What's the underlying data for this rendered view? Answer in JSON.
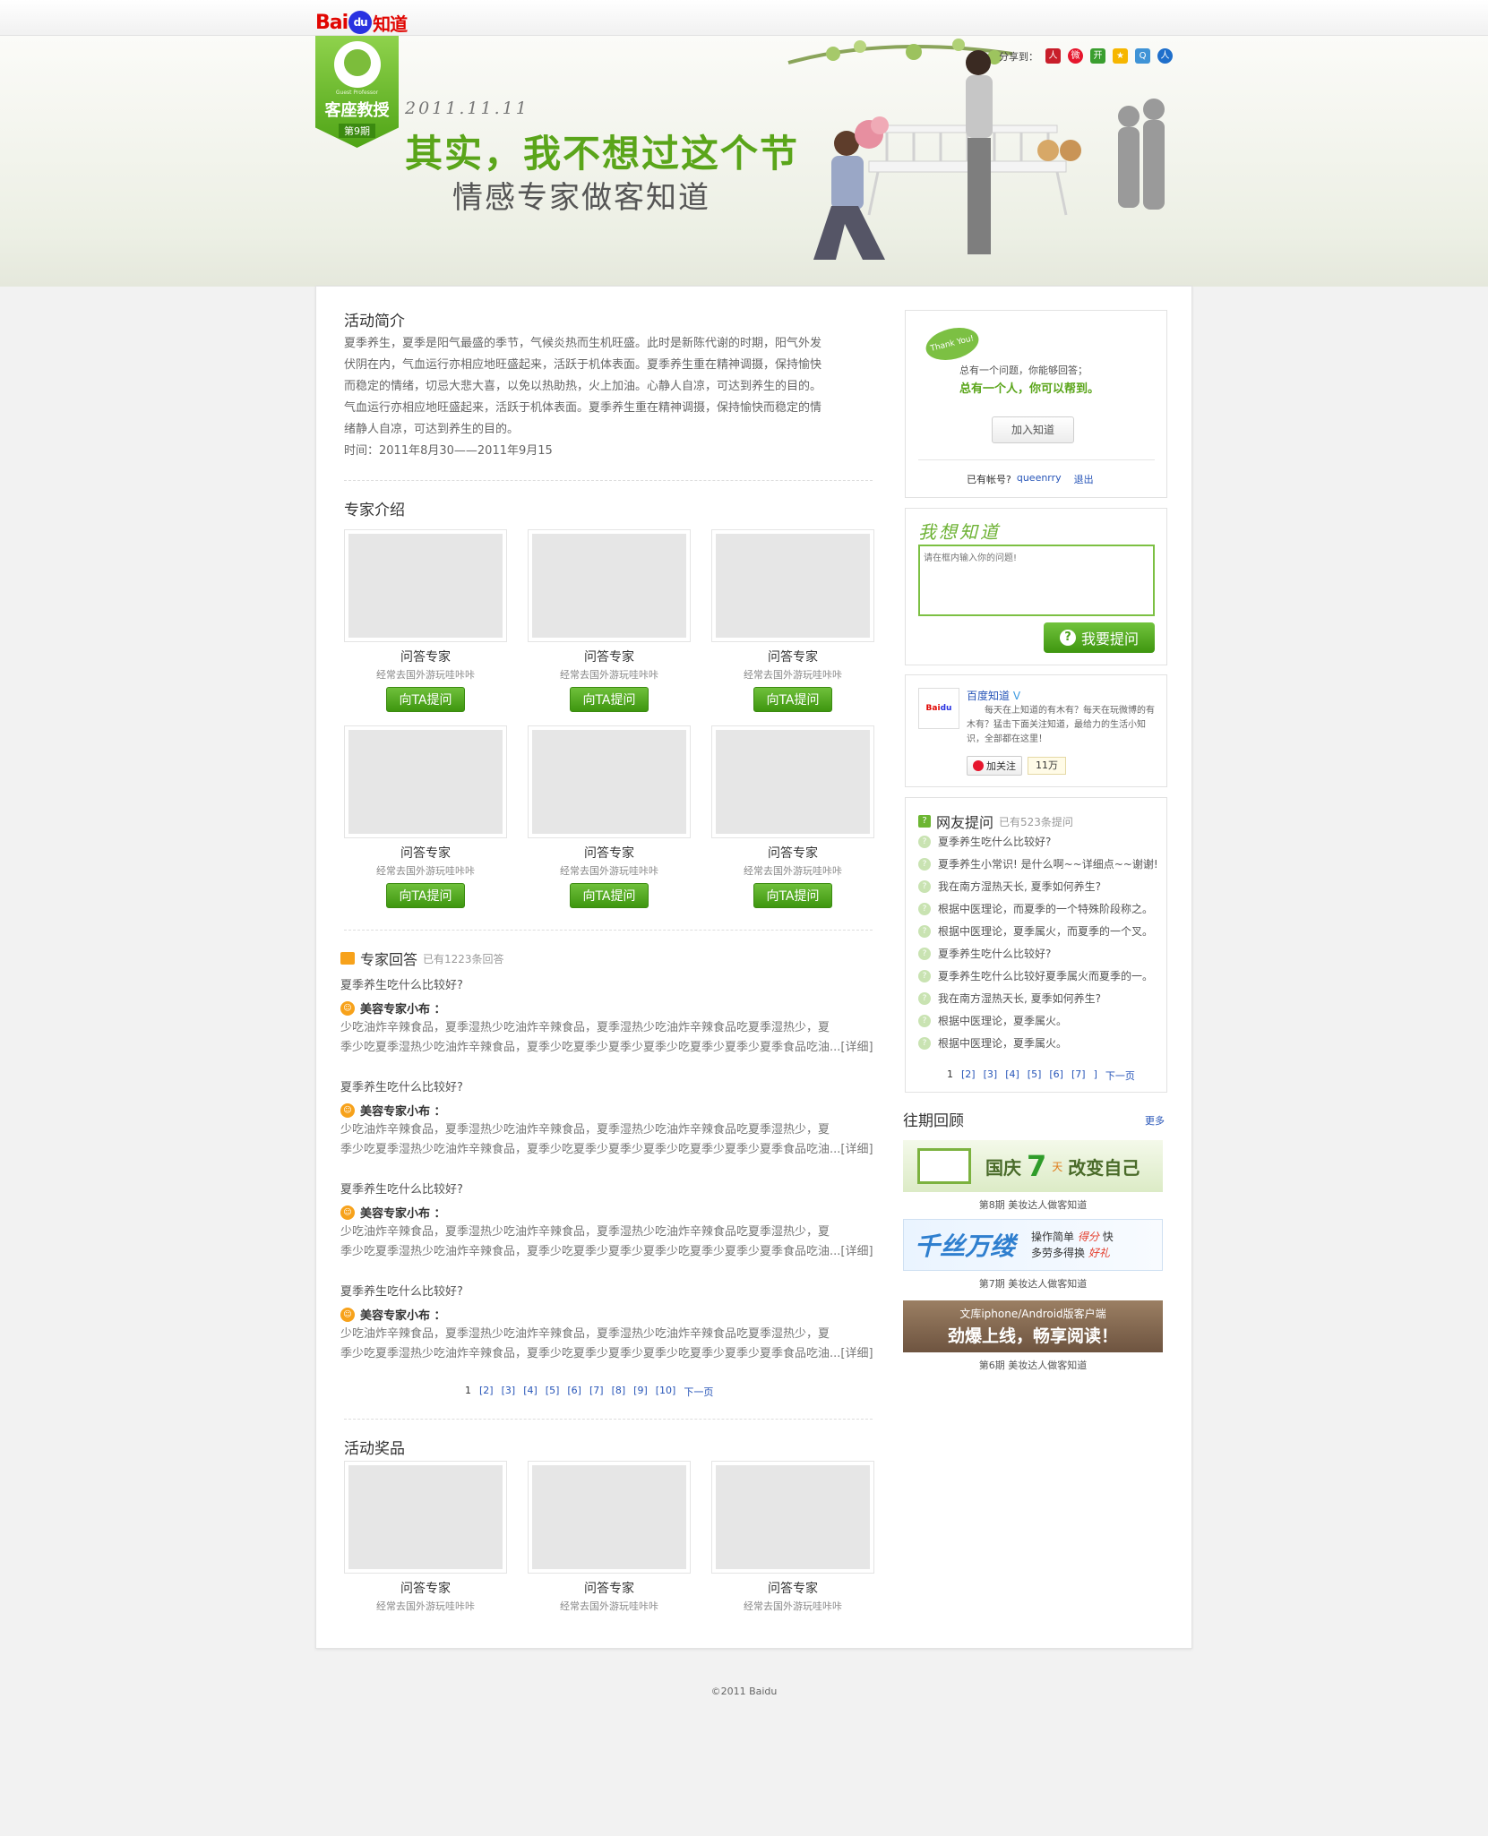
{
  "header": {
    "logo_bai": "Bai",
    "logo_du": "du",
    "logo_zhidao": "知道"
  },
  "banner": {
    "badge_en": "Guest Professor",
    "badge_title": "客座教授",
    "badge_issue": "第9期",
    "date": "2011.11.11",
    "headline": "其实，我不想过这个节",
    "subline": "情感专家做客知道",
    "share_label": "分享到："
  },
  "intro": {
    "title": "活动简介",
    "paragraphs": [
      "夏季养生，夏季是阳气最盛的季节，气候炎热而生机旺盛。此时是新陈代谢的时期，阳气外发",
      "伏阴在内，气血运行亦相应地旺盛起来，活跃于机体表面。夏季养生重在精神调摄，保持愉快",
      "而稳定的情绪，切忌大悲大喜，以免以热助热，火上加油。心静人自凉，可达到养生的目的。",
      "气血运行亦相应地旺盛起来，活跃于机体表面。夏季养生重在精神调摄，保持愉快而稳定的情",
      "绪静人自凉，可达到养生的目的。",
      "时间：2011年8月30——2011年9月15"
    ]
  },
  "experts": {
    "title": "专家介绍",
    "items": [
      {
        "name": "问答专家",
        "desc": "经常去国外游玩哇咔咔",
        "btn": "向TA提问"
      },
      {
        "name": "问答专家",
        "desc": "经常去国外游玩哇咔咔",
        "btn": "向TA提问"
      },
      {
        "name": "问答专家",
        "desc": "经常去国外游玩哇咔咔",
        "btn": "向TA提问"
      },
      {
        "name": "问答专家",
        "desc": "经常去国外游玩哇咔咔",
        "btn": "向TA提问"
      },
      {
        "name": "问答专家",
        "desc": "经常去国外游玩哇咔咔",
        "btn": "向TA提问"
      },
      {
        "name": "问答专家",
        "desc": "经常去国外游玩哇咔咔",
        "btn": "向TA提问"
      }
    ]
  },
  "answers": {
    "title": "专家回答",
    "count": "已有1223条回答",
    "items": [
      {
        "q": "夏季养生吃什么比较好?",
        "expert": "美容专家小布 ：",
        "line1": "少吃油炸辛辣食品，夏季湿热少吃油炸辛辣食品，夏季湿热少吃油炸辛辣食品吃夏季湿热少，夏",
        "line2": "季少吃夏季湿热少吃油炸辛辣食品，夏季少吃夏季少夏季少夏季少吃夏季少夏季少夏季食品吃油...",
        "detail": "[详细]"
      },
      {
        "q": "夏季养生吃什么比较好?",
        "expert": "美容专家小布 ：",
        "line1": "少吃油炸辛辣食品，夏季湿热少吃油炸辛辣食品，夏季湿热少吃油炸辛辣食品吃夏季湿热少，夏",
        "line2": "季少吃夏季湿热少吃油炸辛辣食品，夏季少吃夏季少夏季少夏季少吃夏季少夏季少夏季食品吃油...",
        "detail": "[详细]"
      },
      {
        "q": "夏季养生吃什么比较好?",
        "expert": "美容专家小布 ：",
        "line1": "少吃油炸辛辣食品，夏季湿热少吃油炸辛辣食品，夏季湿热少吃油炸辛辣食品吃夏季湿热少，夏",
        "line2": "季少吃夏季湿热少吃油炸辛辣食品，夏季少吃夏季少夏季少夏季少吃夏季少夏季少夏季食品吃油...",
        "detail": "[详细]"
      },
      {
        "q": "夏季养生吃什么比较好?",
        "expert": "美容专家小布 ：",
        "line1": "少吃油炸辛辣食品，夏季湿热少吃油炸辛辣食品，夏季湿热少吃油炸辛辣食品吃夏季湿热少，夏",
        "line2": "季少吃夏季湿热少吃油炸辛辣食品，夏季少吃夏季少夏季少夏季少吃夏季少夏季少夏季食品吃油...",
        "detail": "[详细]"
      }
    ],
    "pager": {
      "current": "1",
      "pages": [
        "[2]",
        "[3]",
        "[4]",
        "[5]",
        "[6]",
        "[7]",
        "[8]",
        "[9]",
        "[10]"
      ],
      "next": "下一页"
    }
  },
  "prizes": {
    "title": "活动奖品",
    "items": [
      {
        "name": "问答专家",
        "desc": "经常去国外游玩哇咔咔"
      },
      {
        "name": "问答专家",
        "desc": "经常去国外游玩哇咔咔"
      },
      {
        "name": "问答专家",
        "desc": "经常去国外游玩哇咔咔"
      }
    ]
  },
  "login_box": {
    "bubble": "Thank You!",
    "line1": "总有一个问题，你能够回答；",
    "line2": "总有一个人，你可以帮到。",
    "join_btn": "加入知道",
    "account_label": "已有帐号?",
    "username": "queenrry",
    "logout": "退出"
  },
  "ask_box": {
    "title": "我想知道",
    "placeholder": "请在框内输入你的问题!",
    "submit": "我要提问"
  },
  "weibo": {
    "name": "百度知道",
    "desc": "每天在上知道的有木有？每天在玩微博的有木有？猛击下面关注知道，最给力的生活小知识，全部都在这里！",
    "follow": "加关注",
    "fans": "11万"
  },
  "user_questions": {
    "title": "网友提问",
    "count": "已有523条提问",
    "items": [
      "夏季养生吃什么比较好?",
      "夏季养生小常识! 是什么啊~~详细点~~谢谢!",
      "我在南方湿热天长, 夏季如何养生?",
      "根据中医理论，而夏季的一个特殊阶段称之。",
      "根据中医理论，夏季属火，而夏季的一个叉。",
      "夏季养生吃什么比较好?",
      "夏季养生吃什么比较好夏季属火而夏季的一。",
      "我在南方湿热天长, 夏季如何养生?",
      "根据中医理论，夏季属火。",
      "根据中医理论，夏季属火。"
    ],
    "pager": {
      "current": "1",
      "pages": [
        "[2]",
        "[3]",
        "[4]",
        "[5]",
        "[6]",
        "[7]",
        "]"
      ],
      "next": "下一页"
    }
  },
  "past": {
    "title": "往期回顾",
    "more": "更多",
    "items": [
      {
        "banner_a": "国庆",
        "banner_b": "7",
        "banner_c": "天",
        "banner_d": "改变自己",
        "caption": "第8期  美妆达人做客知道"
      },
      {
        "banner_a": "千丝万缕",
        "banner_b": "操作简单",
        "banner_c": "得分",
        "banner_d": "快",
        "banner_e": "多劳多得换",
        "banner_f": "好礼",
        "caption": "第7期  美妆达人做客知道"
      },
      {
        "banner_a": "文库iphone/Android版客户端",
        "banner_b": "劲爆上线，畅享阅读！",
        "caption": "第6期  美妆达人做客知道"
      }
    ]
  },
  "footer": {
    "copyright": "©2011 Baidu"
  }
}
